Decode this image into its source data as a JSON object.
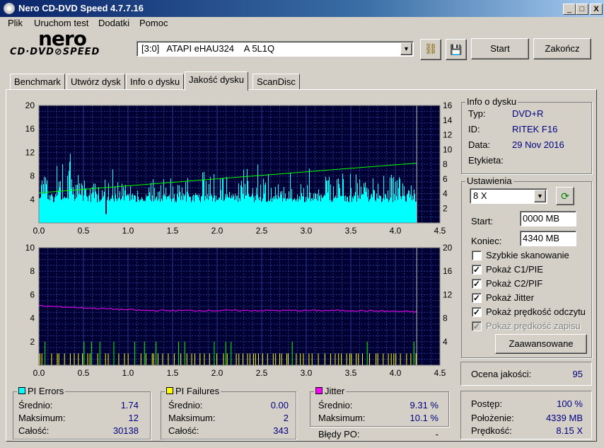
{
  "window": {
    "title": "Nero CD-DVD Speed 4.7.7.16",
    "controls": [
      "_",
      "□",
      "X"
    ]
  },
  "menu": [
    "Plik",
    "Uruchom test",
    "Dodatki",
    "Pomoc"
  ],
  "logo": {
    "top": "nero",
    "bottom": "CD·DVD⊘SPEED"
  },
  "toolbar": {
    "drive": "[3:0]   ATAPI eHAU324    A 5L1Q",
    "start_label": "Start",
    "close_label": "Zakończ"
  },
  "tabs": [
    "Benchmark",
    "Utwórz dysk",
    "Info o dysku",
    "Jakość dysku",
    "ScanDisc"
  ],
  "active_tab": "Jakość dysku",
  "disc_info": {
    "title": "Info o dysku",
    "type_label": "Typ:",
    "type_value": "DVD+R",
    "id_label": "ID:",
    "id_value": "RITEK F16",
    "date_label": "Data:",
    "date_value": "29 Nov 2016",
    "labels_label": "Etykieta:",
    "labels_value": ""
  },
  "settings": {
    "title": "Ustawienia",
    "speed": "8 X",
    "start_label": "Start:",
    "start_value": "0000 MB",
    "end_label": "Koniec:",
    "end_value": "4340 MB",
    "checkboxes": [
      {
        "label": "Szybkie skanowanie",
        "checked": false
      },
      {
        "label": "Pokaż C1/PIE",
        "checked": true
      },
      {
        "label": "Pokaż C2/PIF",
        "checked": true
      },
      {
        "label": "Pokaż Jitter",
        "checked": true
      },
      {
        "label": "Pokaż prędkość odczytu",
        "checked": true
      },
      {
        "label": "Pokaż prędkość zapisu",
        "checked": true,
        "disabled": true
      }
    ],
    "advanced_label": "Zaawansowane"
  },
  "quality": {
    "label": "Ocena jakości:",
    "value": "95"
  },
  "progress": {
    "progress_label": "Postęp:",
    "progress_value": "100 %",
    "position_label": "Położenie:",
    "position_value": "4339 MB",
    "speed_label": "Prędkość:",
    "speed_value": "8.15 X"
  },
  "pi_errors": {
    "title": "PI Errors",
    "color": "#00ffff",
    "avg_label": "Średnio:",
    "avg": "1.74",
    "max_label": "Maksimum:",
    "max": "12",
    "total_label": "Całość:",
    "total": "30138"
  },
  "pi_failures": {
    "title": "PI Failures",
    "color": "#ffff00",
    "avg_label": "Średnio:",
    "avg": "0.00",
    "max_label": "Maksimum:",
    "max": "2",
    "total_label": "Całość:",
    "total": "343"
  },
  "jitter": {
    "title": "Jitter",
    "color": "#ff00ff",
    "avg_label": "Średnio:",
    "avg": "9.31 %",
    "max_label": "Maksimum:",
    "max": "10.1 %",
    "po_label": "Błędy PO:",
    "po": "-"
  },
  "chart_data": [
    {
      "type": "area",
      "x_ticks": [
        "0.0",
        "0.5",
        "1.0",
        "1.5",
        "2.0",
        "2.5",
        "3.0",
        "3.5",
        "4.0",
        "4.5"
      ],
      "y_left_ticks": [
        "4",
        "8",
        "12",
        "16",
        "20"
      ],
      "y_right_ticks": [
        "2",
        "4",
        "6",
        "8",
        "10",
        "12",
        "14",
        "16"
      ],
      "xlim": [
        0,
        4.5
      ],
      "ylim_left": [
        0,
        20
      ],
      "ylim_right": [
        0,
        16
      ],
      "background": "#000033",
      "grid": true,
      "series": [
        {
          "type": "area",
          "color": "#00ffff",
          "base_level": 3.5,
          "peak_max": 12,
          "x_end": 4.24
        },
        {
          "type": "line",
          "color": "#00ff00",
          "x": [
            0,
            4.24
          ],
          "y_right": [
            4.1,
            8.15
          ]
        }
      ],
      "end_marker_x": 4.24
    },
    {
      "type": "bar",
      "x_ticks": [
        "0.0",
        "0.5",
        "1.0",
        "1.5",
        "2.0",
        "2.5",
        "3.0",
        "3.5",
        "4.0",
        "4.5"
      ],
      "y_left_ticks": [
        "2",
        "4",
        "6",
        "8",
        "10"
      ],
      "y_right_ticks": [
        "4",
        "8",
        "12",
        "16",
        "20"
      ],
      "xlim": [
        0,
        4.5
      ],
      "ylim_left": [
        0,
        10
      ],
      "ylim_right": [
        0,
        20
      ],
      "background": "#000033",
      "grid": true,
      "series": [
        {
          "type": "bar",
          "color": "#ffff00",
          "max": 2,
          "x_end": 4.24
        },
        {
          "type": "line",
          "color": "#ff00ff",
          "avg": 9.31,
          "max": 10.1
        }
      ],
      "end_marker_x": 4.24
    }
  ]
}
